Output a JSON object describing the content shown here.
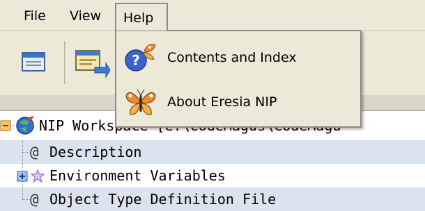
{
  "menubar": {
    "items": [
      {
        "label": "File"
      },
      {
        "label": "View"
      },
      {
        "label": "Help"
      }
    ]
  },
  "help_menu": {
    "items": [
      {
        "label": "Contents and Index",
        "icon": "help-contents-icon"
      },
      {
        "label": "About Eresia NIP",
        "icon": "about-butterfly-icon"
      }
    ]
  },
  "toolbar": {
    "buttons": [
      {
        "icon": "window-icon"
      },
      {
        "icon": "import-icon"
      }
    ]
  },
  "tree": {
    "rows": [
      {
        "label": "NIP Workspace [e:\\CodeMagus\\CodeMagu",
        "icon": "workspace-globe-icon",
        "expander": "collapse"
      },
      {
        "label": "Description",
        "icon": "at-icon"
      },
      {
        "label": "Environment Variables",
        "icon": "star-icon",
        "expander": "expand"
      },
      {
        "label": "Object Type Definition File",
        "icon": "at-icon"
      }
    ]
  },
  "colors": {
    "menu_bg": "#ece9d8",
    "selection_row": "#dbe3ef",
    "border": "#8c8c8c"
  }
}
